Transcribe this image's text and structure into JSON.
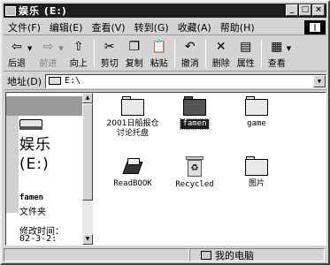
{
  "window": {
    "title": "娱乐 (E:)",
    "buttons": {
      "minimize": "_",
      "maximize": "□",
      "close": "×"
    }
  },
  "menu": [
    "文件(F)",
    "编辑(E)",
    "查看(V)",
    "转到(G)",
    "收藏(A)",
    "帮助(H)"
  ],
  "toolbar": {
    "back": "后退",
    "forward": "前进",
    "up": "向上",
    "cut": "剪切",
    "copy": "复制",
    "paste": "粘贴",
    "undo": "撤消",
    "delete": "删除",
    "properties": "属性",
    "views": "查看"
  },
  "address": {
    "label": "地址(D)",
    "value": "E:\\"
  },
  "left_pane": {
    "drive_name": "娱乐",
    "drive_letter": "(E:)",
    "selected_name": "famen",
    "selected_type": "文件夹",
    "modified_label": "修改时间：",
    "modified_date": "02-3-2:"
  },
  "items": [
    {
      "name": "2001日船报仓讨论托盘"
    },
    {
      "name": "famen"
    },
    {
      "name": "game"
    },
    {
      "name": "ReadBOOK"
    },
    {
      "name": "Recycled"
    },
    {
      "name": "图片"
    }
  ],
  "status": {
    "zone": "我的电脑"
  }
}
